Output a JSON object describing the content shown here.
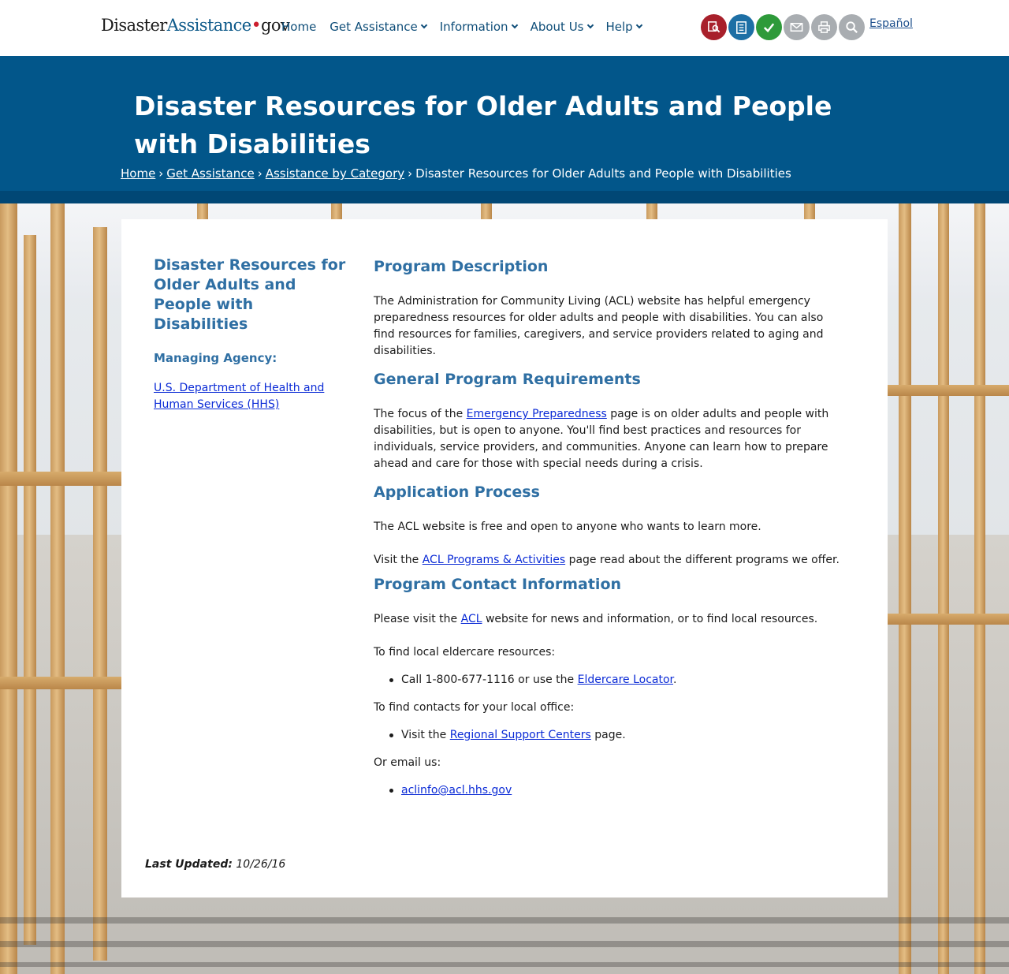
{
  "header": {
    "logo": {
      "part1": "Disaster",
      "part2": "Assistance",
      "dot": "•",
      "part3": "gov"
    },
    "nav": [
      {
        "label": "Home",
        "dropdown": false
      },
      {
        "label": "Get Assistance",
        "dropdown": true
      },
      {
        "label": "Information",
        "dropdown": true
      },
      {
        "label": "About Us",
        "dropdown": true
      },
      {
        "label": "Help",
        "dropdown": true
      }
    ],
    "tools": [
      {
        "icon": "find-assistance-icon",
        "color": "#a8202b"
      },
      {
        "icon": "checklist-icon",
        "color": "#1d6fa5"
      },
      {
        "icon": "checkmark-icon",
        "color": "#2e9a3a"
      },
      {
        "icon": "email-icon",
        "color": "#a9adb1"
      },
      {
        "icon": "print-icon",
        "color": "#a9adb1"
      },
      {
        "icon": "search-icon",
        "color": "#a9adb1"
      }
    ],
    "language_link": "Español"
  },
  "hero": {
    "title": "Disaster Resources for Older Adults and People with Disabilities",
    "breadcrumb": [
      "Home",
      "Get Assistance",
      "Assistance by Category"
    ],
    "breadcrumb_sep": "›",
    "breadcrumb_current": "Disaster Resources for Older Adults and People with Disabilities",
    "background_color": "#02568a"
  },
  "sidebar": {
    "title": "Disaster Resources for Older Adults and People with Disabilities",
    "agency_label": "Managing Agency:",
    "agency_link": "U.S. Department of Health and Human Services (HHS)"
  },
  "main": {
    "description": {
      "heading": "Program Description",
      "text": "The Administration for Community Living (ACL) website has helpful emergency preparedness resources for older adults and people with disabilities. You can also find resources for families, caregivers, and service providers related to aging and disabilities."
    },
    "requirements": {
      "heading": "General Program Requirements",
      "text_before": "The focus of the ",
      "link": "Emergency Preparedness",
      "text_after": " page is on older adults and people with disabilities, but is open to anyone. You'll find best practices and resources for individuals, service providers, and communities. Anyone can learn how to prepare ahead and care for those with special needs during a crisis."
    },
    "application": {
      "heading": "Application Process",
      "text1": "The ACL website is free and open to anyone who wants to learn more.",
      "text2_before": "Visit the ",
      "text2_link": "ACL Programs & Activities",
      "text2_after": " page read about the different programs we offer."
    },
    "contact": {
      "heading": "Program Contact Information",
      "visit_before": "Please visit the ",
      "visit_link": "ACL",
      "visit_after": " website for news and information, or to find local resources.",
      "eldercare_intro": "To find local eldercare resources:",
      "eldercare_item_before": "Call 1-800-677-1116 or use the ",
      "eldercare_item_link": "Eldercare Locator",
      "eldercare_item_after": ".",
      "office_intro": "To find contacts for your local office:",
      "office_item_before": "Visit the ",
      "office_item_link": "Regional Support Centers",
      "office_item_after": " page.",
      "email_intro": "Or email us:",
      "email_link": "aclinfo@acl.hhs.gov"
    }
  },
  "footer": {
    "updated_label": "Last Updated:",
    "updated_date": "10/26/16"
  }
}
